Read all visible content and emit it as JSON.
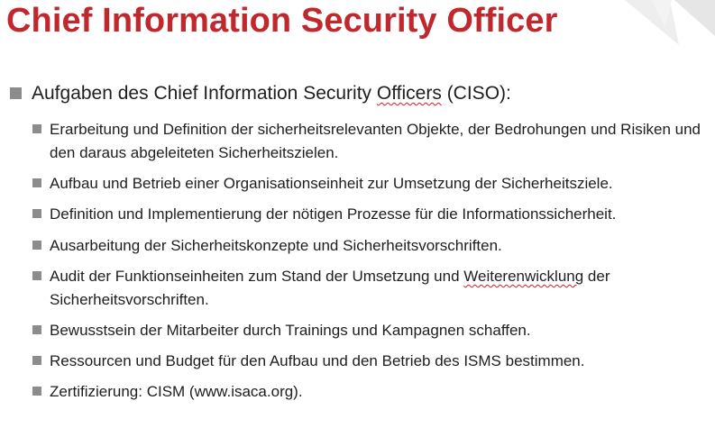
{
  "slide": {
    "title": "Chief Information Security Officer",
    "main_bullet": {
      "prefix": "Aufgaben des Chief Information Security ",
      "underlined": "Officers",
      "suffix": " (CISO):"
    },
    "sub_items": [
      {
        "text": "Erarbeitung und Definition der sicherheitsrelevanten Objekte, der Bedrohungen und Risiken und den daraus abgeleiteten Sicherheitszielen."
      },
      {
        "text": "Aufbau und Betrieb einer Organisationseinheit zur Umsetzung der Sicherheitsziele."
      },
      {
        "text": "Definition und Implementierung der nötigen Prozesse für die Informationssicherheit."
      },
      {
        "text": "Ausarbeitung der Sicherheitskonzepte und Sicherheitsvorschriften."
      },
      {
        "prefix": "Audit der Funktionseinheiten zum Stand der Umsetzung und ",
        "underlined": "Weiterenwicklung",
        "suffix": " der Sicherheitsvorschriften."
      },
      {
        "text": "Bewusstsein der Mitarbeiter durch Trainings und Kampagnen schaffen."
      },
      {
        "text": "Ressourcen und Budget für den Aufbau und den Betrieb des ISMS bestimmen."
      },
      {
        "text": "Zertifizierung: CISM (www.isaca.org)."
      }
    ]
  }
}
